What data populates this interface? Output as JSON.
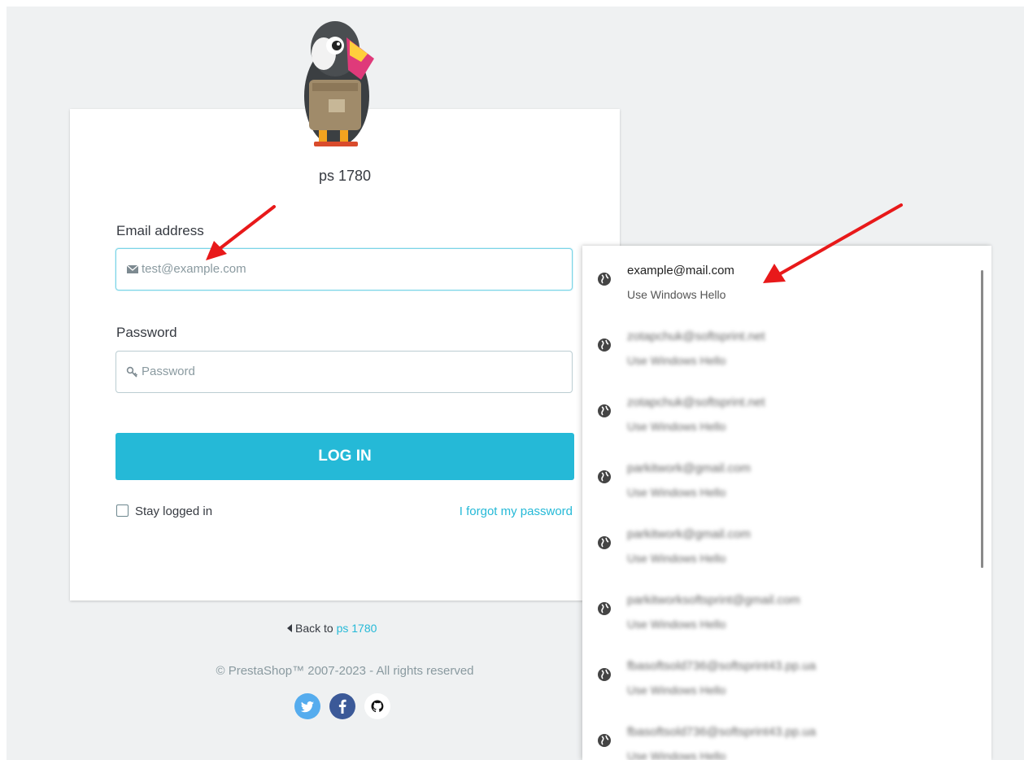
{
  "shop_name": "ps 1780",
  "form": {
    "email_label": "Email address",
    "email_placeholder": "test@example.com",
    "password_label": "Password",
    "password_placeholder": "Password",
    "login_button": "LOG IN",
    "stay_logged_in": "Stay logged in",
    "forgot_password": "I forgot my password"
  },
  "footer": {
    "back_prefix": "Back to",
    "back_link": "ps 1780",
    "copyright": "© PrestaShop™ 2007-2023 - All rights reserved",
    "social": [
      "twitter-icon",
      "facebook-icon",
      "github-icon"
    ]
  },
  "autofill": {
    "items": [
      {
        "email": "example@mail.com",
        "sub": "Use Windows Hello"
      },
      {
        "email": "zotapchuk@softsprint.net",
        "sub": "Use Windows Hello"
      },
      {
        "email": "zotapchuk@softsprint.net",
        "sub": "Use Windows Hello"
      },
      {
        "email": "parkitwork@gmail.com",
        "sub": "Use Windows Hello"
      },
      {
        "email": "parkitwork@gmail.com",
        "sub": "Use Windows Hello"
      },
      {
        "email": "parkitworksoftsprint@gmail.com",
        "sub": "Use Windows Hello"
      },
      {
        "email": "fbasoftsold736@softsprint43.pp.ua",
        "sub": "Use Windows Hello"
      },
      {
        "email": "fbasoftsold736@softsprint43.pp.ua",
        "sub": "Use Windows Hello"
      }
    ]
  },
  "colors": {
    "accent": "#25b9d7",
    "annotation_arrow": "#e8191a"
  }
}
